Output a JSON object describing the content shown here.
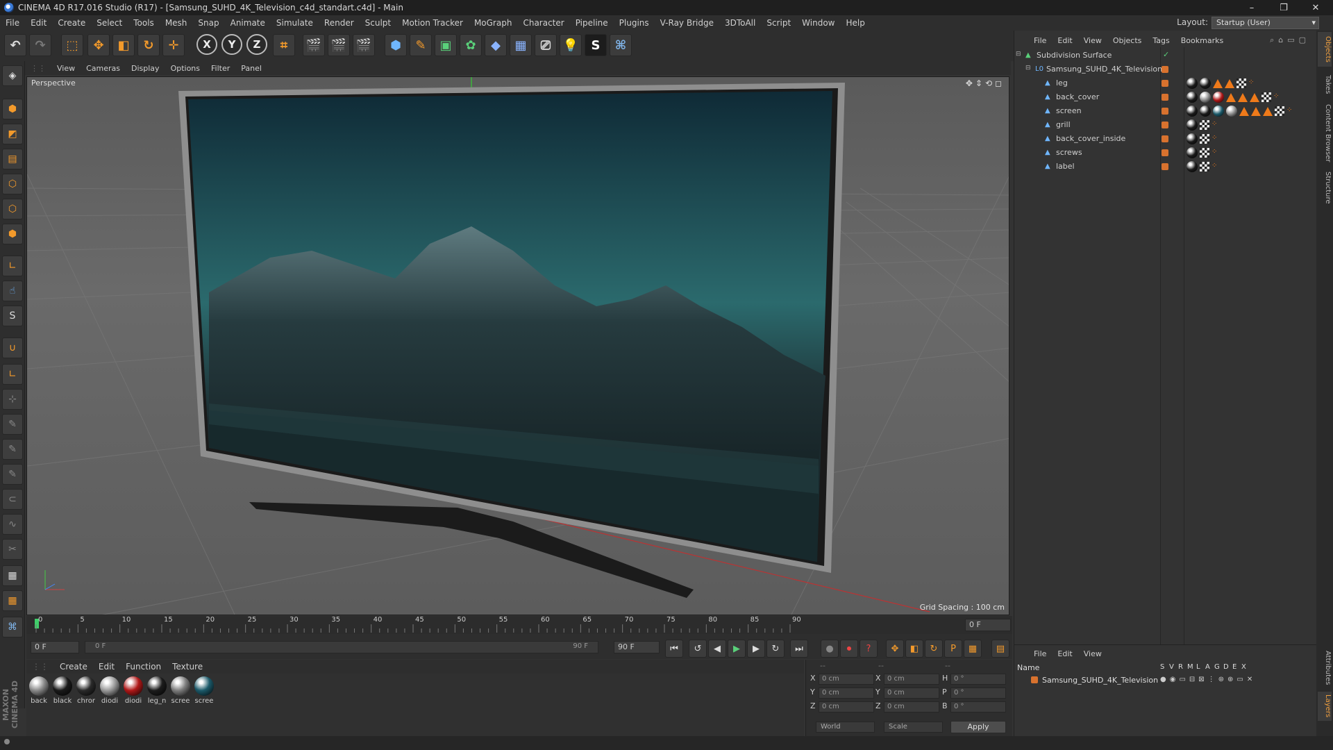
{
  "window": {
    "title": "CINEMA 4D R17.016 Studio (R17) - [Samsung_SUHD_4K_Television_c4d_standart.c4d] - Main",
    "minimize": "–",
    "maximize": "❐",
    "close": "✕"
  },
  "menubar": {
    "items": [
      "File",
      "Edit",
      "Create",
      "Select",
      "Tools",
      "Mesh",
      "Snap",
      "Animate",
      "Simulate",
      "Render",
      "Sculpt",
      "Motion Tracker",
      "MoGraph",
      "Character",
      "Pipeline",
      "Plugins",
      "V-Ray Bridge",
      "3DToAll",
      "Script",
      "Window",
      "Help"
    ],
    "layout_label": "Layout:",
    "layout_value": "Startup (User)"
  },
  "toolbar": {
    "axis_x": "X",
    "axis_y": "Y",
    "axis_z": "Z"
  },
  "viewport": {
    "menu": [
      "View",
      "Cameras",
      "Display",
      "Options",
      "Filter",
      "Panel"
    ],
    "camera_label": "Perspective",
    "grid_spacing": "Grid Spacing : 100 cm"
  },
  "timeline": {
    "ticks": [
      "0",
      "5",
      "10",
      "15",
      "20",
      "25",
      "30",
      "35",
      "40",
      "45",
      "50",
      "55",
      "60",
      "65",
      "70",
      "75",
      "80",
      "85",
      "90"
    ],
    "current_frame": "0 F",
    "start_field": "0 F",
    "range_start": "0 F",
    "range_end": "90 F",
    "end_field": "90 F"
  },
  "materials": {
    "menu": [
      "Create",
      "Edit",
      "Function",
      "Texture"
    ],
    "items": [
      {
        "name": "back",
        "color": "#8a8a8a"
      },
      {
        "name": "black",
        "color": "#1a1a1a"
      },
      {
        "name": "chror",
        "color": "#2a2a2a"
      },
      {
        "name": "diodi",
        "color": "#9a9a9a"
      },
      {
        "name": "diodi",
        "color": "#b01818"
      },
      {
        "name": "leg_n",
        "color": "#1c1c1c"
      },
      {
        "name": "scree",
        "color": "#7d7d7d"
      },
      {
        "name": "scree",
        "color": "#1c5a6a"
      }
    ]
  },
  "coordinates": {
    "header": [
      "--",
      "--",
      "--"
    ],
    "rows": [
      {
        "axis": "X",
        "pos": "0 cm",
        "saxis": "X",
        "size": "0 cm",
        "raxis": "H",
        "rot": "0 °"
      },
      {
        "axis": "Y",
        "pos": "0 cm",
        "saxis": "Y",
        "size": "0 cm",
        "raxis": "P",
        "rot": "0 °"
      },
      {
        "axis": "Z",
        "pos": "0 cm",
        "saxis": "Z",
        "size": "0 cm",
        "raxis": "B",
        "rot": "0 °"
      }
    ],
    "mode": "World",
    "transform": "Scale",
    "apply": "Apply"
  },
  "object_manager": {
    "menu": [
      "File",
      "Edit",
      "View",
      "Objects",
      "Tags",
      "Bookmarks"
    ],
    "objects": [
      {
        "name": "Subdivision Surface",
        "depth": 0,
        "tags": []
      },
      {
        "name": "Samsung_SUHD_4K_Television",
        "depth": 1,
        "tags": []
      },
      {
        "name": "leg",
        "depth": 2,
        "tags": [
          "ball-black",
          "ball-black",
          "tri",
          "tri",
          "chk",
          "uv"
        ]
      },
      {
        "name": "back_cover",
        "depth": 2,
        "tags": [
          "ball-black",
          "ball-grey",
          "ball-red",
          "tri",
          "tri",
          "tri",
          "chk",
          "uv"
        ]
      },
      {
        "name": "screen",
        "depth": 2,
        "tags": [
          "ball-black",
          "ball-black",
          "ball-teal",
          "ball-grey",
          "tri",
          "tri",
          "tri",
          "chk",
          "uv"
        ]
      },
      {
        "name": "grill",
        "depth": 2,
        "tags": [
          "ball-black",
          "chk",
          "uv"
        ]
      },
      {
        "name": "back_cover_inside",
        "depth": 2,
        "tags": [
          "ball-black",
          "chk",
          "uv"
        ]
      },
      {
        "name": "screws",
        "depth": 2,
        "tags": [
          "ball-black",
          "chk",
          "uv"
        ]
      },
      {
        "name": "label",
        "depth": 2,
        "tags": [
          "ball-black",
          "chk",
          "uv"
        ]
      }
    ]
  },
  "layer_manager": {
    "menu": [
      "File",
      "Edit",
      "View"
    ],
    "name_header": "Name",
    "columns": [
      "S",
      "V",
      "R",
      "M",
      "L",
      "A",
      "G",
      "D",
      "E",
      "X"
    ],
    "layers": [
      {
        "name": "Samsung_SUHD_4K_Television"
      }
    ]
  },
  "side_tabs": [
    "Objects",
    "Takes",
    "Content Browser",
    "Structure"
  ],
  "side_tabs_bottom": [
    "Attributes",
    "Layers"
  ],
  "branding": "MAXON CINEMA 4D"
}
